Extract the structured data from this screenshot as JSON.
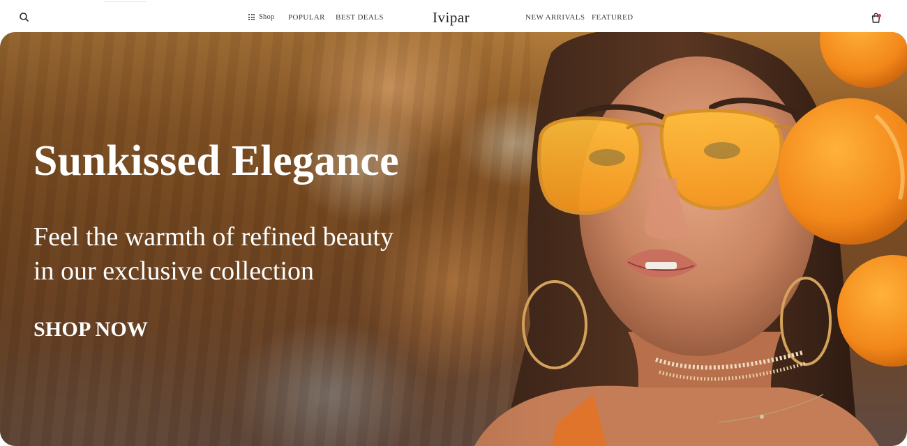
{
  "header": {
    "logo": "Ivipar",
    "nav_left": [
      "Shop",
      "POPULAR",
      "BEST DEALS"
    ],
    "nav_right": [
      "NEW ARRIVALS",
      "FEATURED"
    ],
    "icons": {
      "search": "search-icon",
      "shop": "grid-icon",
      "cart": "shopping-bag-icon",
      "cart_badge": "notification-dot"
    }
  },
  "hero": {
    "title": "Sunkissed Elegance",
    "subtitle_lines": [
      "Feel the warmth of refined beauty",
      "in our exclusive collection"
    ],
    "cta": "SHOP NOW",
    "image": "woman-orange-sunglasses-photo"
  },
  "colors": {
    "accent_badge": "#e0403a",
    "text_on_hero": "#ffffff",
    "lens": "#f5a623",
    "orange_fruit": "#f28a1a"
  }
}
